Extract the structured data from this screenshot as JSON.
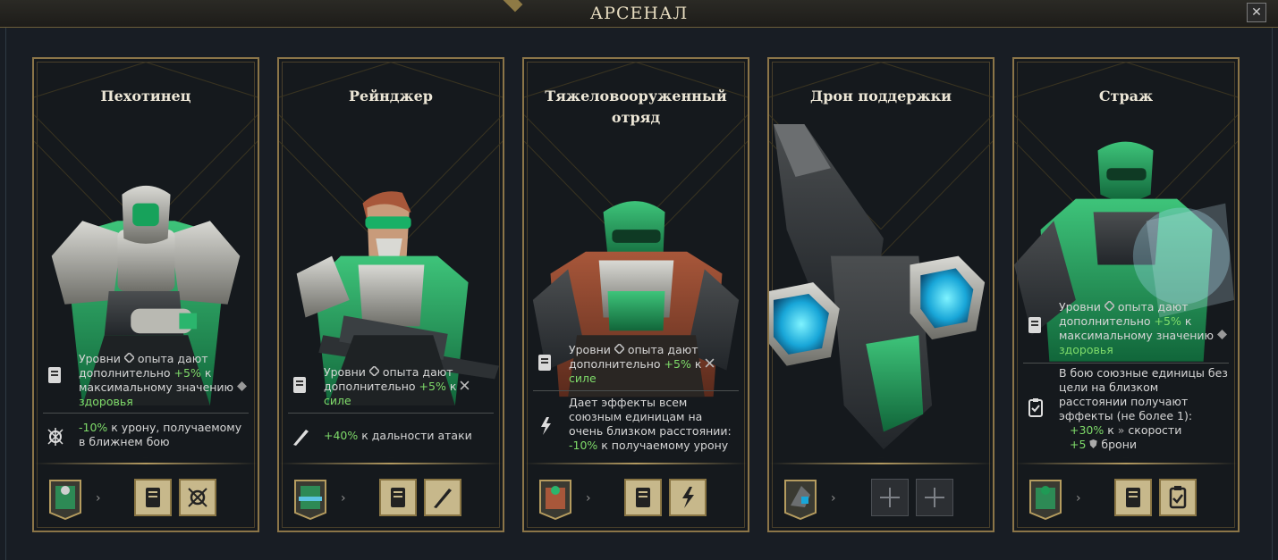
{
  "header": {
    "title": "АРСЕНАЛ",
    "close_symbol": "✕"
  },
  "cards": [
    {
      "name": "Пехотинец",
      "desc1": {
        "pre": "Уровни ",
        "icon": "xp-diamond-icon",
        "mid": " опыта дают дополнительно ",
        "value": "+5%",
        "post": " к максимальному значению ",
        "stat": "здоровья"
      },
      "desc2": {
        "value": "-10%",
        "post": " к урону, получаемому в ближнем бою"
      },
      "slots": [
        "manual-icon",
        "bug-shield-icon"
      ]
    },
    {
      "name": "Рейнджер",
      "desc1": {
        "pre": "Уровни ",
        "icon": "xp-diamond-icon",
        "mid": " опыта дают дополнительно ",
        "value": "+5%",
        "post": " к ",
        "stat": "силе"
      },
      "desc2": {
        "value": "+40%",
        "post": " к дальности атаки"
      },
      "slots": [
        "manual-icon",
        "rifle-icon"
      ]
    },
    {
      "name": "Тяжеловооруженный отряд",
      "desc1": {
        "pre": "Уровни ",
        "icon": "xp-diamond-icon",
        "mid": " опыта дают дополнительно ",
        "value": "+5%",
        "post": " к ",
        "stat": "силе"
      },
      "desc2": {
        "pre": "Дает эффекты всем союзным единицам на очень близком расстоянии: ",
        "value": "-10%",
        "post": " к получаемому урону"
      },
      "slots": [
        "manual-icon",
        "aura-icon"
      ]
    },
    {
      "name": "Дрон поддержки",
      "slots": [
        "plus-icon",
        "plus-icon"
      ],
      "plus": "+"
    },
    {
      "name": "Страж",
      "desc1": {
        "pre": "Уровни ",
        "icon": "xp-diamond-icon",
        "mid": " опыта дают дополнительно ",
        "value": "+5%",
        "post": " к максимальному значению ",
        "stat": "здоровья"
      },
      "desc2": {
        "pre": "В бою союзные единицы без цели на близком расстоянии получают эффекты (не более 1):",
        "line1_value": "+30%",
        "line1_post": " к ",
        "line1_stat": "скорости",
        "line2_value": "+5",
        "line2_stat": "брони"
      },
      "slots": [
        "manual-icon",
        "clipboard-icon"
      ]
    }
  ],
  "colors": {
    "gold": "#8b7548",
    "highlight": "#7fdc6a",
    "armor_green": "#1f9a55"
  }
}
